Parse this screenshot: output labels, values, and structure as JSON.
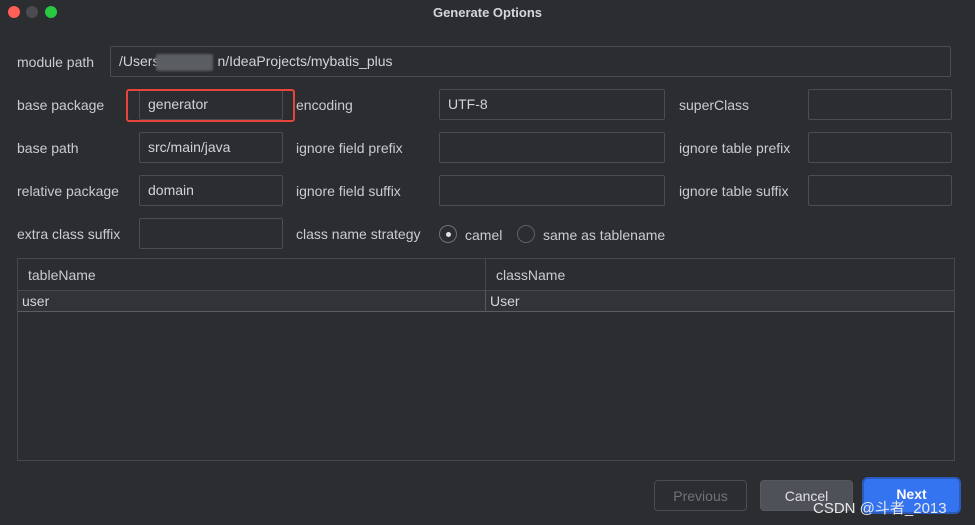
{
  "window": {
    "title": "Generate Options"
  },
  "form": {
    "module_path": {
      "label": "module path",
      "value_start": "/Users",
      "value_end": "n/IdeaProjects/mybatis_plus"
    },
    "base_package": {
      "label": "base package",
      "value": "generator"
    },
    "encoding": {
      "label": "encoding",
      "value": "UTF-8"
    },
    "super_class": {
      "label": "superClass",
      "value": ""
    },
    "base_path": {
      "label": "base path",
      "value": "src/main/java"
    },
    "ignore_field_prefix": {
      "label": "ignore field prefix",
      "value": ""
    },
    "ignore_table_prefix": {
      "label": "ignore table prefix",
      "value": ""
    },
    "relative_package": {
      "label": "relative package",
      "value": "domain"
    },
    "ignore_field_suffix": {
      "label": "ignore field suffix",
      "value": ""
    },
    "ignore_table_suffix": {
      "label": "ignore table suffix",
      "value": ""
    },
    "extra_class_suffix": {
      "label": "extra class suffix",
      "value": ""
    },
    "class_name_strategy": {
      "label": "class name strategy",
      "options": [
        "camel",
        "same as tablename"
      ],
      "selected": "camel"
    }
  },
  "table": {
    "columns": [
      "tableName",
      "className"
    ],
    "rows": [
      {
        "tableName": "user",
        "className": "User"
      }
    ]
  },
  "buttons": {
    "previous": "Previous",
    "cancel": "Cancel",
    "next": "Next"
  },
  "watermark": "CSDN @斗者_2013",
  "colors": {
    "accent": "#3574f0",
    "highlight": "#e7443b",
    "background": "#2b2d30"
  }
}
